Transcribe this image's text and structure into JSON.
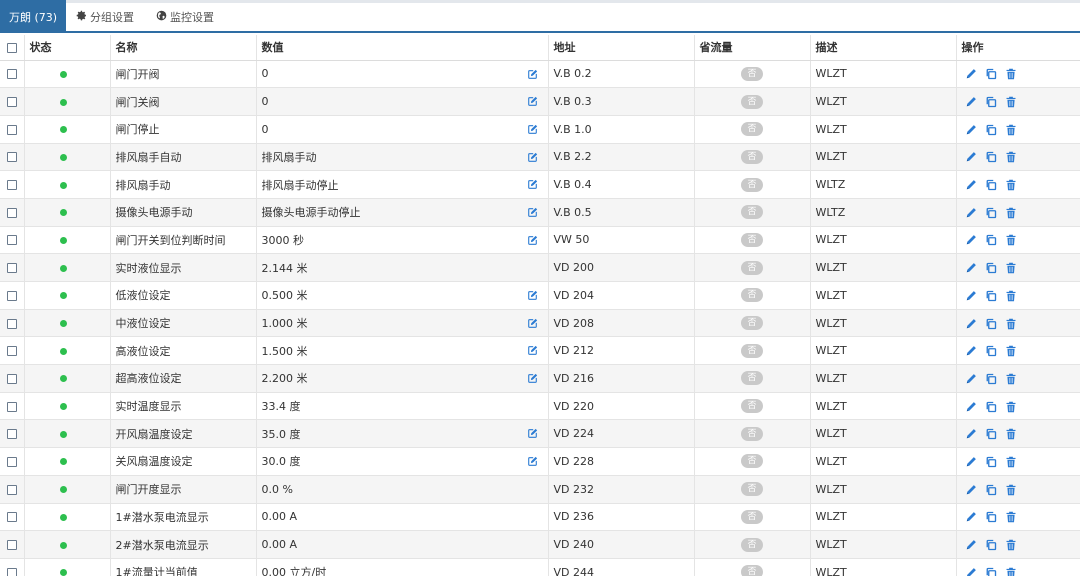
{
  "tabs": [
    {
      "label": "万朗 (73)",
      "icon": ""
    },
    {
      "label": "分组设置",
      "icon": "gear-icon"
    },
    {
      "label": "监控设置",
      "icon": "globe-icon"
    }
  ],
  "columns": [
    "",
    "状态",
    "名称",
    "数值",
    "地址",
    "省流量",
    "描述",
    "操作"
  ],
  "colors": {
    "accent": "#2e6da4",
    "status_ok": "#2dbf4e",
    "pill": "#c9c9c9",
    "action": "#2b7bd3"
  },
  "rows": [
    {
      "name": "闸门开阀",
      "value": "0",
      "editable": true,
      "address": "V.B 0.2",
      "flow": "否",
      "desc": "WLZT"
    },
    {
      "name": "闸门关阀",
      "value": "0",
      "editable": true,
      "address": "V.B 0.3",
      "flow": "否",
      "desc": "WLZT"
    },
    {
      "name": "闸门停止",
      "value": "0",
      "editable": true,
      "address": "V.B 1.0",
      "flow": "否",
      "desc": "WLZT"
    },
    {
      "name": "排风扇手自动",
      "value": "排风扇手动",
      "editable": true,
      "address": "V.B 2.2",
      "flow": "否",
      "desc": "WLZT"
    },
    {
      "name": "排风扇手动",
      "value": "排风扇手动停止",
      "editable": true,
      "address": "V.B 0.4",
      "flow": "否",
      "desc": "WLTZ"
    },
    {
      "name": "摄像头电源手动",
      "value": "摄像头电源手动停止",
      "editable": true,
      "address": "V.B 0.5",
      "flow": "否",
      "desc": "WLTZ"
    },
    {
      "name": "闸门开关到位判断时间",
      "value": "3000 秒",
      "editable": true,
      "address": "VW 50",
      "flow": "否",
      "desc": "WLZT"
    },
    {
      "name": "实时液位显示",
      "value": "2.144 米",
      "editable": false,
      "address": "VD 200",
      "flow": "否",
      "desc": "WLZT"
    },
    {
      "name": "低液位设定",
      "value": "0.500 米",
      "editable": true,
      "address": "VD 204",
      "flow": "否",
      "desc": "WLZT"
    },
    {
      "name": "中液位设定",
      "value": "1.000 米",
      "editable": true,
      "address": "VD 208",
      "flow": "否",
      "desc": "WLZT"
    },
    {
      "name": "高液位设定",
      "value": "1.500 米",
      "editable": true,
      "address": "VD 212",
      "flow": "否",
      "desc": "WLZT"
    },
    {
      "name": "超高液位设定",
      "value": "2.200 米",
      "editable": true,
      "address": "VD 216",
      "flow": "否",
      "desc": "WLZT"
    },
    {
      "name": "实时温度显示",
      "value": "33.4 度",
      "editable": false,
      "address": "VD 220",
      "flow": "否",
      "desc": "WLZT"
    },
    {
      "name": "开风扇温度设定",
      "value": "35.0 度",
      "editable": true,
      "address": "VD 224",
      "flow": "否",
      "desc": "WLZT"
    },
    {
      "name": "关风扇温度设定",
      "value": "30.0 度",
      "editable": true,
      "address": "VD 228",
      "flow": "否",
      "desc": "WLZT"
    },
    {
      "name": "闸门开度显示",
      "value": "0.0 %",
      "editable": false,
      "address": "VD 232",
      "flow": "否",
      "desc": "WLZT"
    },
    {
      "name": "1#潜水泵电流显示",
      "value": "0.00 A",
      "editable": false,
      "address": "VD 236",
      "flow": "否",
      "desc": "WLZT"
    },
    {
      "name": "2#潜水泵电流显示",
      "value": "0.00 A",
      "editable": false,
      "address": "VD 240",
      "flow": "否",
      "desc": "WLZT"
    },
    {
      "name": "1#流量计当前值",
      "value": "0.00 立方/时",
      "editable": false,
      "address": "VD 244",
      "flow": "否",
      "desc": "WLZT"
    }
  ]
}
